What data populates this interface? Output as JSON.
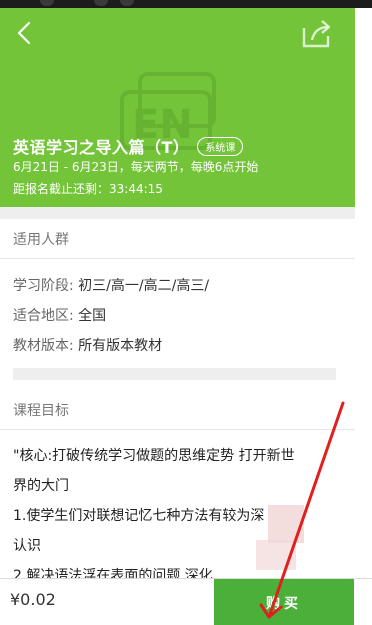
{
  "header": {
    "title": "英语学习之导入篇（T）",
    "badge": "系统课",
    "schedule": "6月21日 - 6月23日，每天两节，每晚6点开始",
    "countdown": "距报名截止还剩：33:44:15",
    "watermark_text": "EN"
  },
  "audience": {
    "heading": "适用人群",
    "rows": [
      {
        "label": "学习阶段:",
        "value": "初三/高一/高二/高三/"
      },
      {
        "label": "适合地区:",
        "value": "全国"
      },
      {
        "label": "教材版本:",
        "value": "所有版本教材"
      }
    ]
  },
  "goals": {
    "heading": "课程目标",
    "lines": [
      "\"核心:打破传统学习做题的思维定势 打开新世",
      "界的大门",
      "1.使学生们对联想记忆七种方法有较为深",
      "认识",
      "2.解决语法浮在表面的问题 深化"
    ]
  },
  "footer": {
    "price": "¥0.02",
    "buy_label": "购买"
  },
  "colors": {
    "hero_green": "#74c43a",
    "buy_green": "#4bb03a",
    "annotation_red": "#e02020"
  }
}
